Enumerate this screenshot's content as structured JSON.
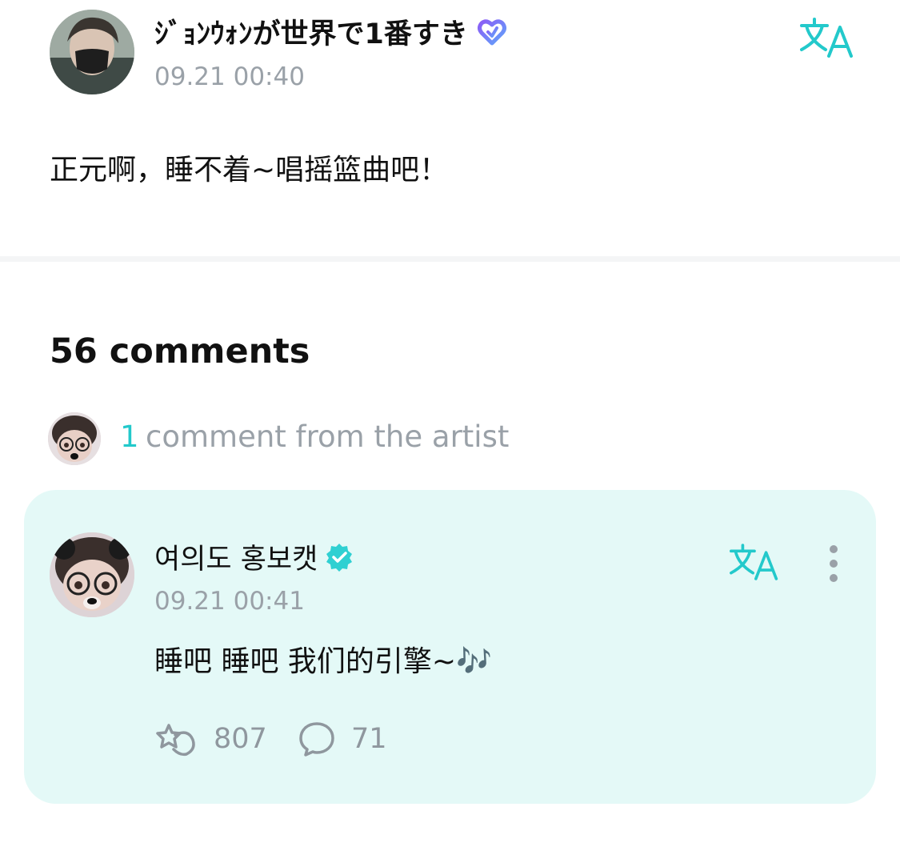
{
  "post": {
    "author": "ｼﾞｮﾝｳｫﾝが世界で1番すき",
    "badge_icon": "purple-heart-badge-icon",
    "timestamp": "09.21 00:40",
    "text": "正元啊，睡不着~唱摇篮曲吧！",
    "translate_icon": "translate-icon"
  },
  "comments": {
    "heading": "56 comments",
    "artist_summary": {
      "count": "1",
      "label": "comment from the artist"
    }
  },
  "artist_comment": {
    "author": "여의도 홍보캣",
    "verified_icon": "verified-badge-icon",
    "timestamp": "09.21 00:41",
    "text": "睡吧 睡吧 我们的引擎~🎶",
    "likes": "807",
    "replies": "71",
    "more_icon": "more-vertical-icon"
  },
  "colors": {
    "accent_teal": "#23c9cb",
    "card_background": "#e4f9f7",
    "muted_text": "#9aa1a8",
    "badge_purple": "#8b5cf6",
    "badge_blue": "#60a5fa"
  }
}
